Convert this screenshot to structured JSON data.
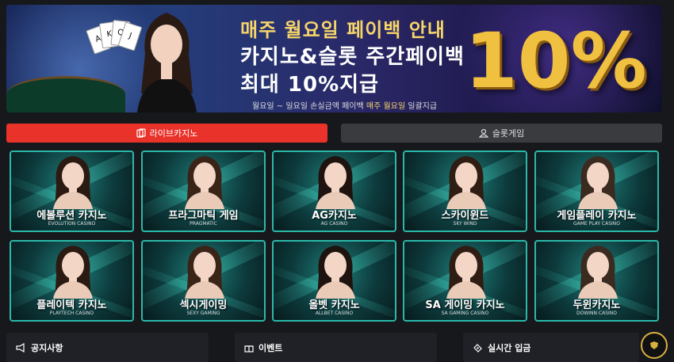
{
  "banner": {
    "title1": "매주 월요일 페이백 안내",
    "title2": "카지노&슬롯 주간페이백",
    "title3": "최대 10%지급",
    "subtitle_pre": "월요일 ~ 일요일 손실금액 페이백 ",
    "subtitle_hl": "매주 월요일",
    "subtitle_post": " 일괄지급",
    "percent": "10%"
  },
  "tabs": [
    {
      "label": "라이브카지노",
      "active": true
    },
    {
      "label": "슬롯게임",
      "active": false
    }
  ],
  "games": [
    {
      "name": "에볼루션 카지노",
      "en": "EVOLUTION CASINO"
    },
    {
      "name": "프라그마틱 게임",
      "en": "PRAGMATIC"
    },
    {
      "name": "AG카지노",
      "en": "AG CASINO"
    },
    {
      "name": "스카이윈드",
      "en": "SKY WIND"
    },
    {
      "name": "게임플레이 카지노",
      "en": "GAME PLAY CASINO"
    },
    {
      "name": "플레이텍 카지노",
      "en": "PLAYTECH CASINO"
    },
    {
      "name": "섹시게이밍",
      "en": "SEXY GAMING"
    },
    {
      "name": "올벳 카지노",
      "en": "ALLBET CASINO"
    },
    {
      "name": "SA 게이밍 카지노",
      "en": "SA GAMING CASINO"
    },
    {
      "name": "두윈카지노",
      "en": "DOWINN CASINO"
    }
  ],
  "panels": [
    {
      "label": "공지사항"
    },
    {
      "label": "이벤트"
    },
    {
      "label": "실시간 입금"
    }
  ],
  "colors": {
    "accent": "#e8322a",
    "tile_border": "#2ab8a8",
    "gold": "#f0c040"
  }
}
